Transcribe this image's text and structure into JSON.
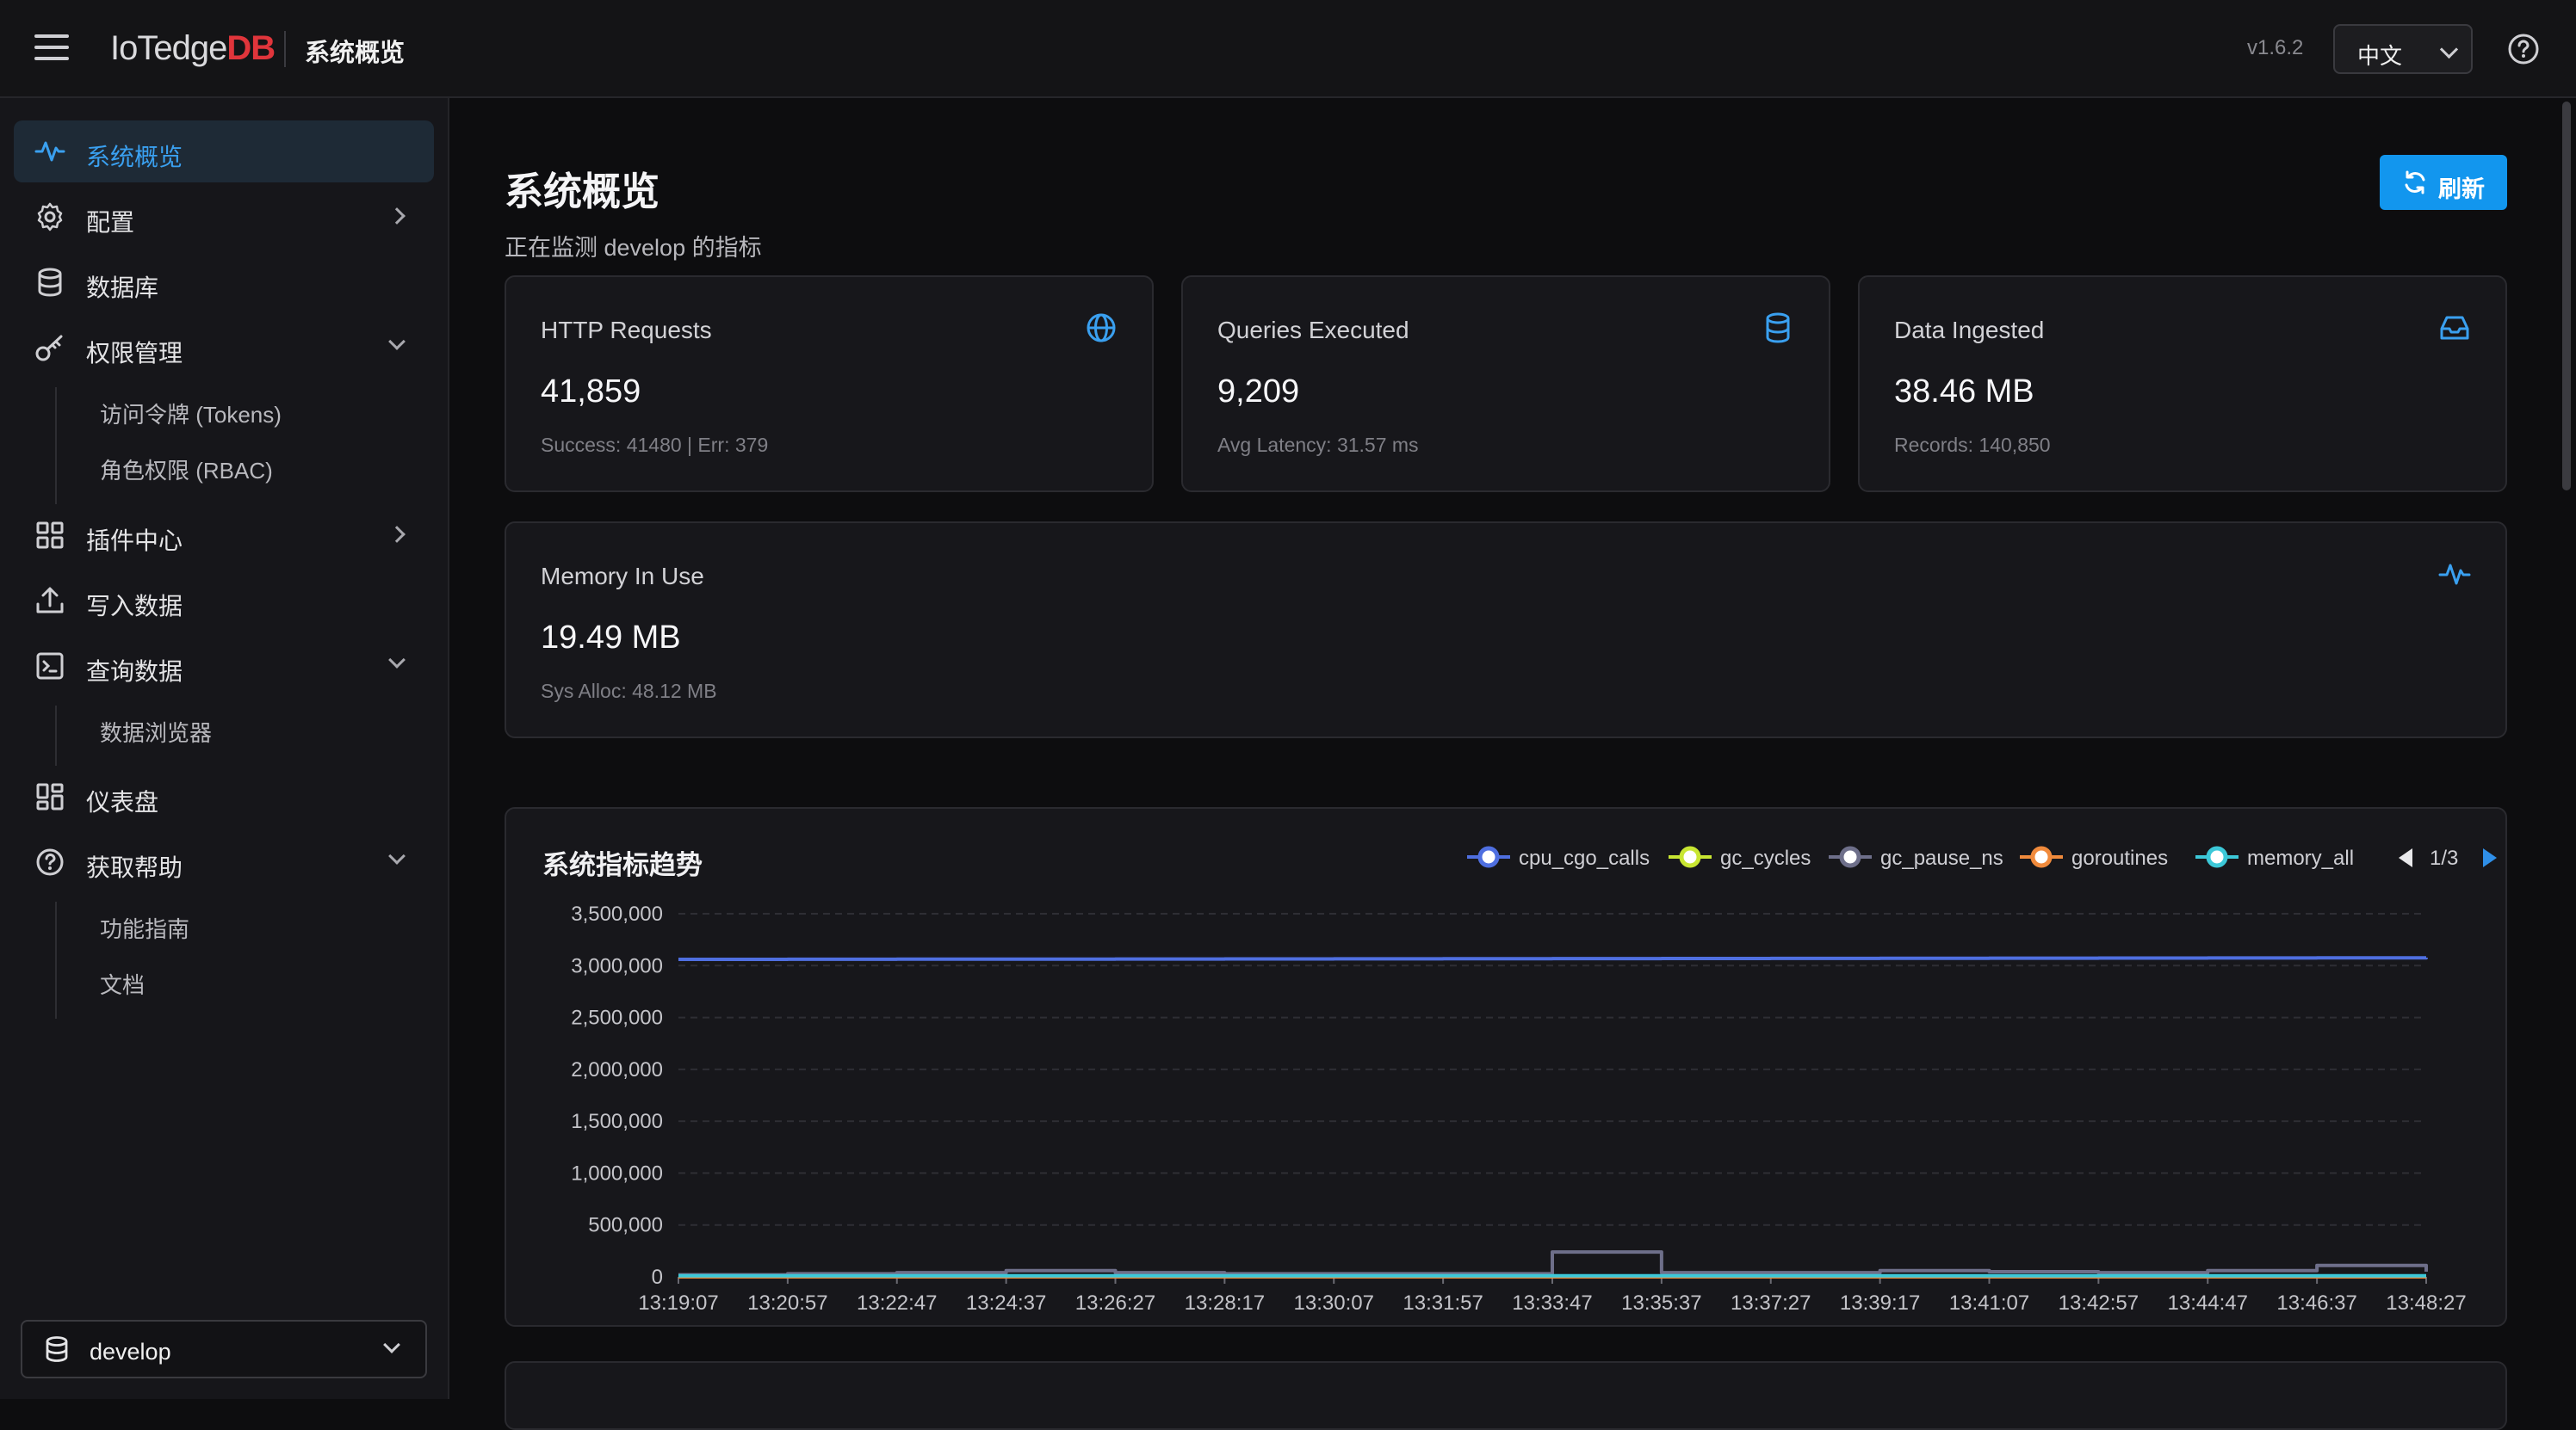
{
  "topbar": {
    "logo_main": "IoTedge",
    "logo_accent": "DB",
    "title": "系统概览",
    "version": "v1.6.2",
    "language": "中文"
  },
  "sidebar": {
    "items": [
      {
        "label": "系统概览",
        "icon": "activity-icon",
        "active": true
      },
      {
        "label": "配置",
        "icon": "gear-icon",
        "arrow": "right"
      },
      {
        "label": "数据库",
        "icon": "database-icon"
      },
      {
        "label": "权限管理",
        "icon": "key-icon",
        "arrow": "down",
        "children": [
          "访问令牌 (Tokens)",
          "角色权限 (RBAC)"
        ]
      },
      {
        "label": "插件中心",
        "icon": "grid-icon",
        "arrow": "right"
      },
      {
        "label": "写入数据",
        "icon": "upload-icon"
      },
      {
        "label": "查询数据",
        "icon": "terminal-icon",
        "arrow": "down",
        "children": [
          "数据浏览器"
        ]
      },
      {
        "label": "仪表盘",
        "icon": "dashboard-icon"
      },
      {
        "label": "获取帮助",
        "icon": "help-circle-icon",
        "arrow": "down",
        "children": [
          "功能指南",
          "文档"
        ]
      }
    ],
    "database_selector": "develop"
  },
  "main": {
    "title": "系统概览",
    "subtitle": "正在监测 develop 的指标",
    "refresh_label": "刷新",
    "colors": {
      "accent": "#1296ee",
      "card_icon": "#3aa0f0"
    },
    "cards": [
      {
        "title": "HTTP Requests",
        "value": "41,859",
        "sub": "Success: 41480 | Err: 379",
        "icon": "globe-icon"
      },
      {
        "title": "Queries Executed",
        "value": "9,209",
        "sub": "Avg Latency: 31.57 ms",
        "icon": "database-icon"
      },
      {
        "title": "Data Ingested",
        "value": "38.46 MB",
        "sub": "Records: 140,850",
        "icon": "inbox-icon"
      },
      {
        "title": "Memory In Use",
        "value": "19.49 MB",
        "sub": "Sys Alloc: 48.12 MB",
        "icon": "activity-icon"
      }
    ]
  },
  "chart_data": {
    "type": "line",
    "title": "系统指标趋势",
    "legend_page": "1/3",
    "legend_placement": "top-right",
    "grid": true,
    "ylim": [
      0,
      3500000
    ],
    "yticks": [
      "3,500,000",
      "3,000,000",
      "2,500,000",
      "2,000,000",
      "1,500,000",
      "1,000,000",
      "500,000",
      "0"
    ],
    "x": [
      "13:19:07",
      "13:20:57",
      "13:22:47",
      "13:24:37",
      "13:26:27",
      "13:28:17",
      "13:30:07",
      "13:31:57",
      "13:33:47",
      "13:35:37",
      "13:37:27",
      "13:39:17",
      "13:41:07",
      "13:42:57",
      "13:44:47",
      "13:46:37",
      "13:48:27"
    ],
    "series": [
      {
        "name": "cpu_cgo_calls",
        "color": "#4f6fe0",
        "values": [
          3060000,
          3061000,
          3062000,
          3063000,
          3064000,
          3065000,
          3066000,
          3067000,
          3068000,
          3069000,
          3070000,
          3071000,
          3072000,
          3073000,
          3074000,
          3075000,
          3077000
        ]
      },
      {
        "name": "gc_cycles",
        "color": "#c8e632",
        "values": [
          100,
          100,
          100,
          100,
          100,
          100,
          100,
          100,
          100,
          100,
          100,
          100,
          100,
          100,
          100,
          100,
          100
        ]
      },
      {
        "name": "gc_pause_ns",
        "color": "#6e6f8a",
        "values": [
          20000,
          30000,
          40000,
          60000,
          40000,
          30000,
          30000,
          30000,
          240000,
          40000,
          40000,
          60000,
          50000,
          40000,
          60000,
          110000,
          50000
        ]
      },
      {
        "name": "goroutines",
        "color": "#f08a3c",
        "values": [
          40,
          40,
          40,
          40,
          40,
          40,
          40,
          40,
          40,
          40,
          40,
          40,
          40,
          40,
          40,
          40,
          40
        ]
      },
      {
        "name": "memory_all",
        "color": "#3cc8d8",
        "values": [
          10000,
          10000,
          10000,
          10000,
          10000,
          10000,
          10000,
          10000,
          10000,
          10000,
          10000,
          10000,
          10000,
          10000,
          10000,
          10000,
          10000
        ]
      }
    ]
  }
}
